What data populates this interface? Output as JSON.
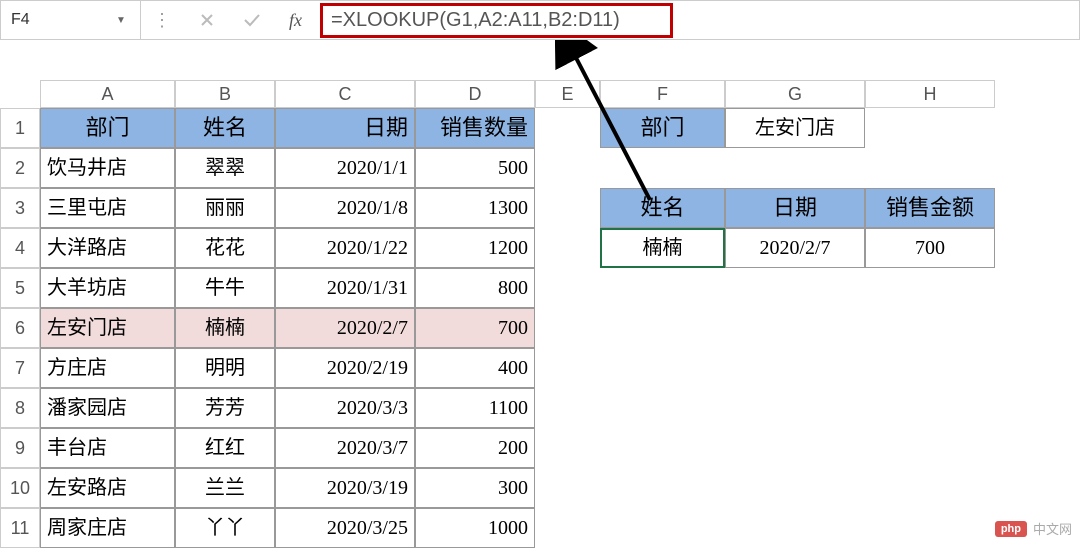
{
  "formula_bar": {
    "cell_ref": "F4",
    "formula": "=XLOOKUP(G1,A2:A11,B2:D11)",
    "fx_label": "fx"
  },
  "columns": [
    "A",
    "B",
    "C",
    "D",
    "E",
    "F",
    "G",
    "H"
  ],
  "rows": [
    "1",
    "2",
    "3",
    "4",
    "5",
    "6",
    "7",
    "8",
    "9",
    "10",
    "11"
  ],
  "headers": {
    "a": "部门",
    "b": "姓名",
    "c": "日期",
    "d": "销售数量"
  },
  "right_top": {
    "f1": "部门",
    "g1": "左安门店"
  },
  "right_headers": {
    "f3": "姓名",
    "g3": "日期",
    "h3": "销售金额"
  },
  "right_values": {
    "f4": "楠楠",
    "g4": "2020/2/7",
    "h4": "700"
  },
  "data": [
    {
      "a": "饮马井店",
      "b": "翠翠",
      "c": "2020/1/1",
      "d": "500"
    },
    {
      "a": "三里屯店",
      "b": "丽丽",
      "c": "2020/1/8",
      "d": "1300"
    },
    {
      "a": "大洋路店",
      "b": "花花",
      "c": "2020/1/22",
      "d": "1200"
    },
    {
      "a": "大羊坊店",
      "b": "牛牛",
      "c": "2020/1/31",
      "d": "800"
    },
    {
      "a": "左安门店",
      "b": "楠楠",
      "c": "2020/2/7",
      "d": "700"
    },
    {
      "a": "方庄店",
      "b": "明明",
      "c": "2020/2/19",
      "d": "400"
    },
    {
      "a": "潘家园店",
      "b": "芳芳",
      "c": "2020/3/3",
      "d": "1100"
    },
    {
      "a": "丰台店",
      "b": "红红",
      "c": "2020/3/7",
      "d": "200"
    },
    {
      "a": "左安路店",
      "b": "兰兰",
      "c": "2020/3/19",
      "d": "300"
    },
    {
      "a": "周家庄店",
      "b": "丫丫",
      "c": "2020/3/25",
      "d": "1000"
    }
  ],
  "watermark": {
    "badge": "php",
    "text": "中文网"
  }
}
